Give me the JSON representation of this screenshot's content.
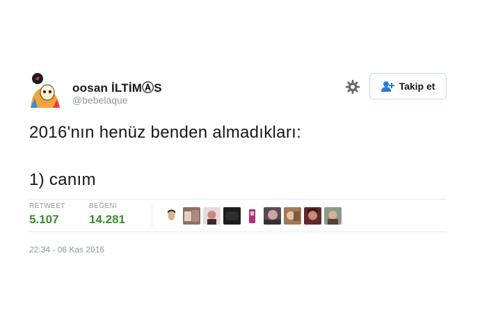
{
  "author": {
    "name": "oosan İLTİMⒶS",
    "handle": "@bebelaque"
  },
  "follow_button": {
    "label": "Takip et",
    "icon": "add-user-icon"
  },
  "settings_icon": "gear-icon",
  "tweet_text": {
    "line1": "2016'nın henüz benden almadıkları:",
    "line2": "1) canım"
  },
  "stats": {
    "retweet_label": "RETWEET",
    "retweet_count": "5.107",
    "like_label": "BEĞENİ",
    "like_count": "14.281"
  },
  "colors": {
    "stat_value": "#3a8a2e",
    "muted": "#8899a6",
    "divider": "#e6ecf0"
  },
  "timestamp": "22:34 - 06 Kas 2016"
}
